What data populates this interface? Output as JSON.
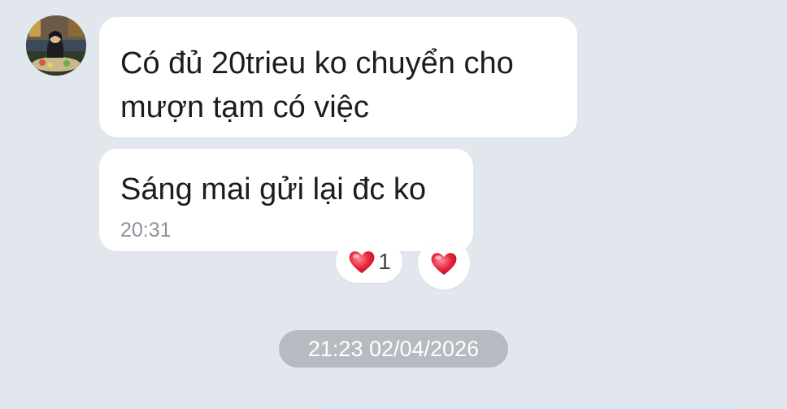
{
  "conversation": {
    "messages": [
      {
        "text": "Có đủ 20trieu ko chuyển cho mượn tạm có việc"
      },
      {
        "text": "Sáng mai gửi lại đc ko",
        "time": "20:31"
      }
    ],
    "reactions": {
      "heart_count": "1",
      "icon": "heart-icon"
    },
    "date_separator": "21:23 02/04/2026"
  },
  "colors": {
    "background": "#e2e7ee",
    "bubble_incoming": "#ffffff",
    "bubble_outgoing": "#d4e9fb",
    "date_pill": "#b6bbc2",
    "heart": "#e8283c"
  }
}
